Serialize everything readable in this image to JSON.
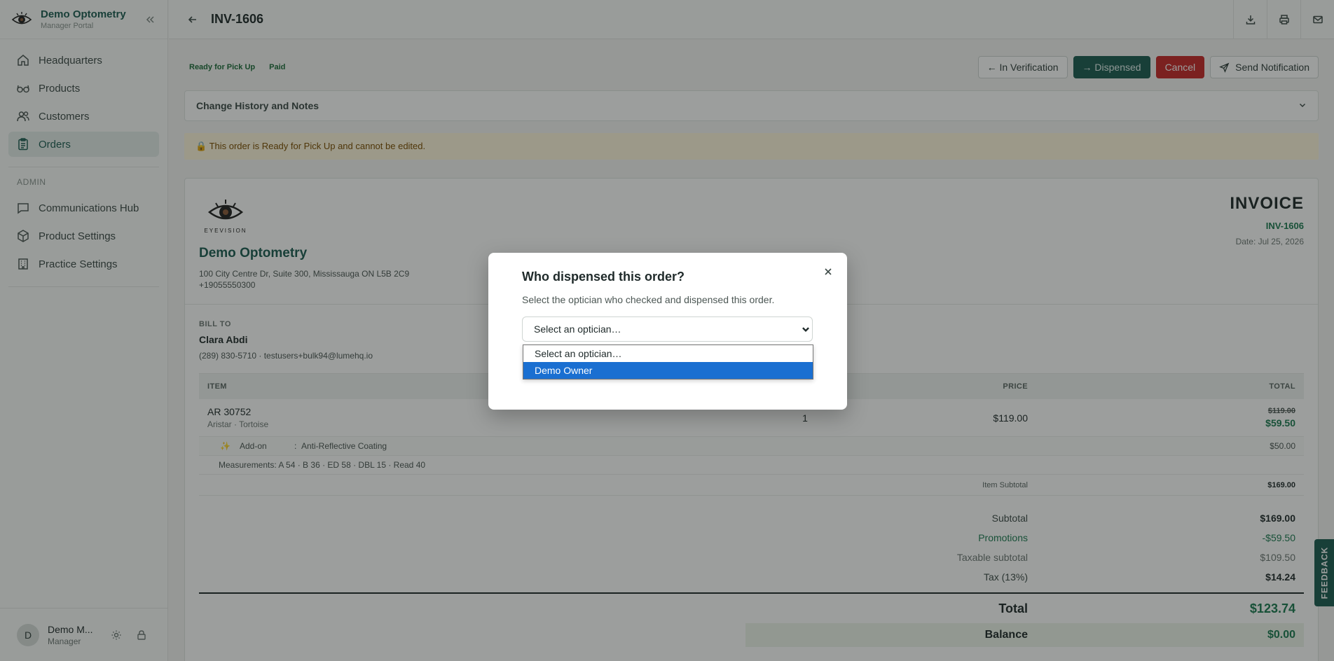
{
  "sidebar": {
    "brand_name": "Demo Optometry",
    "brand_sub": "Manager Portal",
    "nav": [
      {
        "label": "Headquarters",
        "icon": "home-icon"
      },
      {
        "label": "Products",
        "icon": "glasses-icon"
      },
      {
        "label": "Customers",
        "icon": "users-icon"
      },
      {
        "label": "Orders",
        "icon": "clipboard-icon",
        "active": true
      }
    ],
    "admin_label": "ADMIN",
    "admin_nav": [
      {
        "label": "Communications Hub",
        "icon": "message-icon"
      },
      {
        "label": "Product Settings",
        "icon": "box-icon"
      },
      {
        "label": "Practice Settings",
        "icon": "building-icon"
      }
    ],
    "user": {
      "initial": "D",
      "name": "Demo M...",
      "role": "Manager"
    }
  },
  "header": {
    "title": "INV-1606"
  },
  "status": {
    "badges": [
      "Ready for Pick Up",
      "Paid"
    ],
    "actions": {
      "verification": "← In Verification",
      "dispensed": "→ Dispensed",
      "cancel": "Cancel",
      "notify": "Send Notification"
    }
  },
  "history": {
    "title": "Change History and Notes"
  },
  "lock_notice": "🔒 This order is Ready for Pick Up and cannot be edited.",
  "invoice": {
    "logo_text": "EYEVISION",
    "company": "Demo Optometry",
    "address": "100 City Centre Dr, Suite 300, Mississauga ON L5B 2C9",
    "phone": "+19055550300",
    "title": "INVOICE",
    "number": "INV-1606",
    "date": "Date: Jul 25, 2026",
    "bill_to_label": "BILL TO",
    "customer_name": "Clara Abdi",
    "customer_contact": "(289) 830-5710 · testusers+bulk94@lumehq.io",
    "columns": {
      "item": "ITEM",
      "price": "PRICE",
      "total": "TOTAL"
    },
    "item": {
      "name": "AR 30752",
      "sub": "Aristar · Tortoise",
      "qty": "1",
      "price": "$119.00",
      "total_original": "$119.00",
      "total": "$59.50"
    },
    "addon": {
      "icon": "✨",
      "label": "Add-on",
      "sep": ":",
      "name": "Anti-Reflective Coating",
      "price": "$50.00"
    },
    "measurements": "Measurements: A 54 · B 36 · ED 58 · DBL 15 · Read 40",
    "item_subtotal_label": "Item Subtotal",
    "item_subtotal": "$169.00",
    "totals": {
      "subtotal_label": "Subtotal",
      "subtotal": "$169.00",
      "promotions_label": "Promotions",
      "promotions": "-$59.50",
      "taxable_label": "Taxable subtotal",
      "taxable": "$109.50",
      "tax_label": "Tax (13%)",
      "tax": "$14.24",
      "total_label": "Total",
      "total": "$123.74",
      "balance_label": "Balance",
      "balance": "$0.00"
    }
  },
  "feedback": "FEEDBACK",
  "modal": {
    "title": "Who dispensed this order?",
    "description": "Select the optician who checked and dispensed this order.",
    "select_value": "Select an optician…",
    "options": [
      "Select an optician…",
      "Demo Owner"
    ]
  },
  "colors": {
    "brand": "#1d5c52",
    "danger": "#c62828",
    "success": "#1d7a52",
    "highlight": "#1a6fd1"
  }
}
